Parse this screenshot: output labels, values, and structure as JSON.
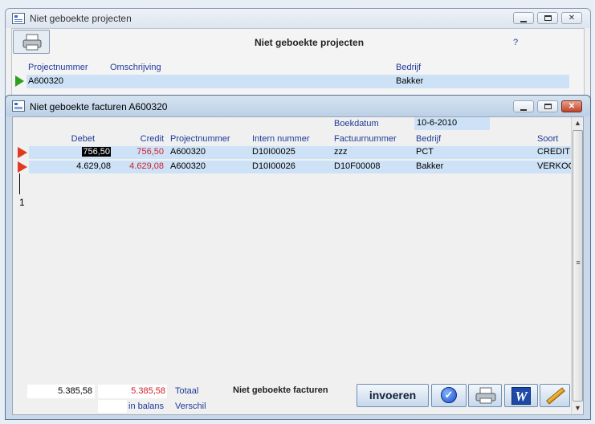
{
  "window_back": {
    "title": "Niet geboekte projecten",
    "heading": "Niet geboekte projecten",
    "help": "?",
    "columns": [
      "Projectnummer",
      "Omschrijving",
      "Bedrijf"
    ],
    "rows": [
      {
        "projectnummer": "A600320",
        "omschrijving": "",
        "bedrijf": "Bakker"
      }
    ]
  },
  "window_front": {
    "title": "Niet geboekte facturen A600320",
    "boekdatum_label": "Boekdatum",
    "boekdatum_value": "10-6-2010",
    "columns": [
      "Debet",
      "Credit",
      "Projectnummer",
      "Intern nummer",
      "Factuurnummer",
      "Bedrijf",
      "Soort"
    ],
    "rows": [
      {
        "debet": "756,50",
        "credit": "756,50",
        "projectnummer": "A600320",
        "intern": "D10I00025",
        "factuur": "zzz",
        "bedrijf": "PCT",
        "soort": "CREDIT"
      },
      {
        "debet": "4.629,08",
        "credit": "4.629,08",
        "projectnummer": "A600320",
        "intern": "D10I00026",
        "factuur": "D10F00008",
        "bedrijf": "Bakker",
        "soort": "VERKOO"
      }
    ],
    "record_marker": "1",
    "totals": {
      "debet_total": "5.385,58",
      "credit_total": "5.385,58",
      "totaal_label": "Totaal",
      "verschil_value": "",
      "balance_label": "in balans",
      "verschil_label": "Verschil"
    },
    "footer_title": "Niet geboekte facturen",
    "buttons": {
      "invoeren": "invoeren",
      "icons": [
        "check-icon",
        "printer-icon",
        "word-icon",
        "pencil-icon"
      ]
    }
  },
  "colors": {
    "row_highlight": "#cde2f7",
    "credit_red": "#d0202a",
    "header_blue": "#1f3a9a",
    "arrow_green": "#2fa020",
    "arrow_red": "#e03a20"
  }
}
